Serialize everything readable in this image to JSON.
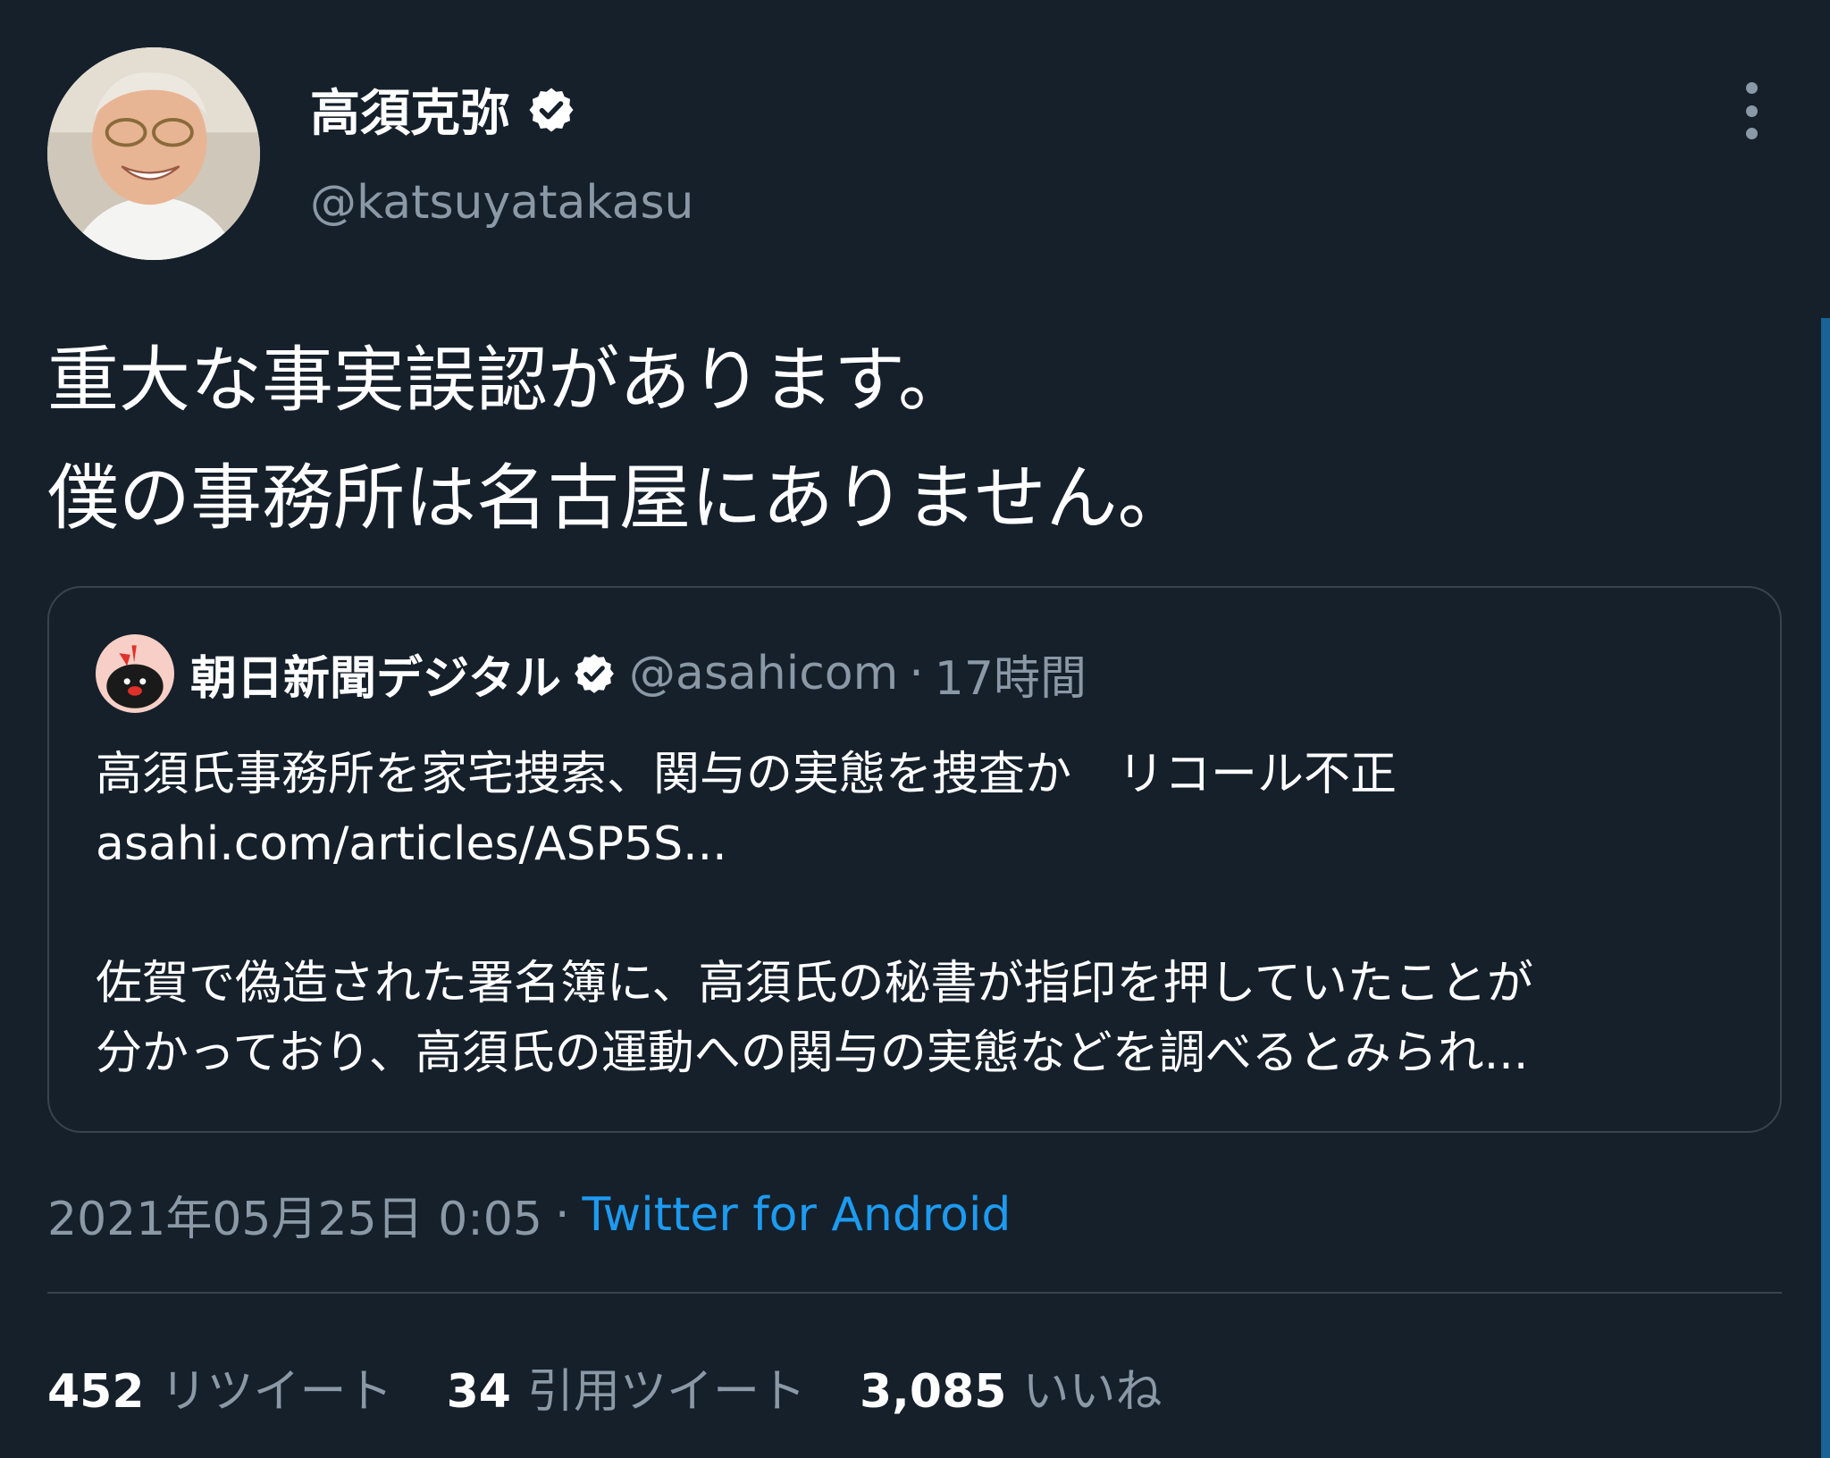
{
  "colors": {
    "background": "#15202b",
    "text_primary": "#ffffff",
    "text_secondary": "#8b98a5",
    "link": "#1d9bf0",
    "border": "#38444d"
  },
  "tweet": {
    "author": {
      "display_name": "高須克弥",
      "handle": "@katsuyatakasu",
      "verified": true,
      "avatar_icon": "profile-photo"
    },
    "more_icon": "more-vertical-icon",
    "text_lines": [
      "重大な事実誤認があります。",
      "僕の事務所は名古屋にありません。"
    ],
    "quoted": {
      "display_name": "朝日新聞デジタル",
      "handle": "@asahicom",
      "separator": "·",
      "time": "17時間",
      "verified": true,
      "headline": "高須氏事務所を家宅捜索、関与の実態を捜査か　リコール不正",
      "link": "asahi.com/articles/ASP5S...",
      "summary_lines": [
        "佐賀で偽造された署名簿に、高須氏の秘書が指印を押していたことが",
        "分かっており、高須氏の運動への関与の実態などを調べるとみられ..."
      ]
    },
    "timestamp": "2021年05月25日 0:05",
    "meta_separator": "·",
    "source": "Twitter for Android",
    "stats": [
      {
        "count": "452",
        "label": "リツイート"
      },
      {
        "count": "34",
        "label": "引用ツイート"
      },
      {
        "count": "3,085",
        "label": "いいね"
      }
    ]
  }
}
